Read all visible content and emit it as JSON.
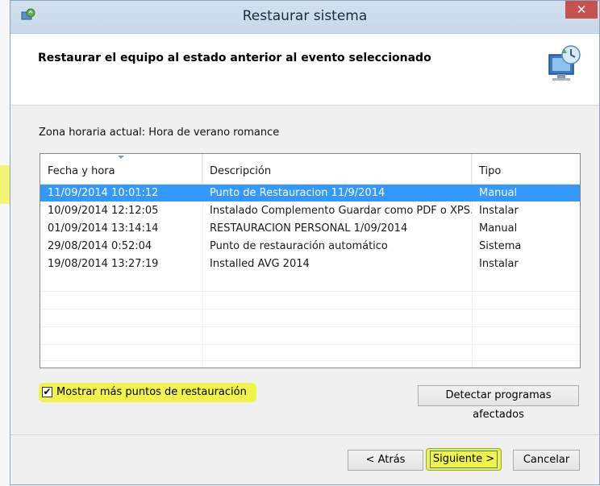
{
  "window": {
    "title": "Restaurar sistema",
    "close_glyph": "✕"
  },
  "header": {
    "title": "Restaurar el equipo al estado anterior al evento seleccionado",
    "icon": "system-restore-icon"
  },
  "timezone_text": "Zona horaria actual: Hora de verano romance",
  "restore_list": {
    "columns": [
      "Fecha y hora",
      "Descripción",
      "Tipo"
    ],
    "selected_index": 0,
    "rows": [
      {
        "date": "11/09/2014 10:01:12",
        "description": "Punto de Restauracion 11/9/2014",
        "type": "Manual"
      },
      {
        "date": "10/09/2014 12:12:05",
        "description": "Instalado Complemento Guardar como PDF o XPS…",
        "type": "Instalar"
      },
      {
        "date": "01/09/2014 13:14:14",
        "description": "RESTAURACION PERSONAL 1/09/2014",
        "type": "Manual"
      },
      {
        "date": "29/08/2014 0:52:04",
        "description": "Punto de restauración automático",
        "type": "Sistema"
      },
      {
        "date": "19/08/2014 13:27:19",
        "description": "Installed AVG 2014",
        "type": "Instalar"
      }
    ]
  },
  "show_more": {
    "label": "Mostrar más puntos de restauración",
    "checked": true,
    "check_glyph": "✔"
  },
  "buttons": {
    "detect": "Detectar programas afectados",
    "back": "< Atrás",
    "next": "Siguiente >",
    "cancel": "Cancelar"
  },
  "colors": {
    "selection": "#3399ff",
    "highlight": "#f1f34a",
    "close": "#c75050"
  }
}
